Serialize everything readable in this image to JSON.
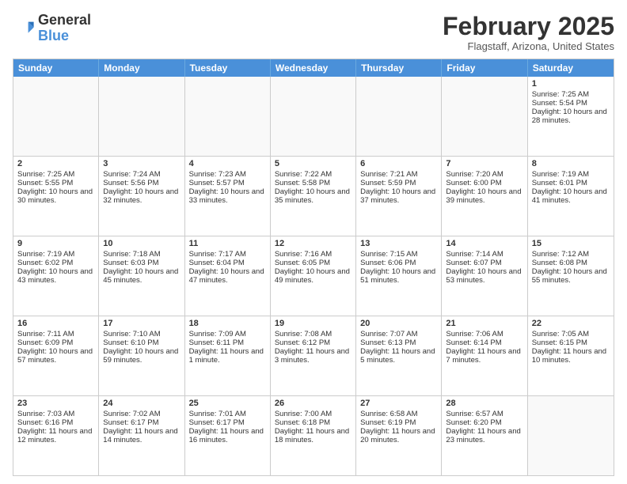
{
  "header": {
    "logo_line1": "General",
    "logo_line2": "Blue",
    "month": "February 2025",
    "location": "Flagstaff, Arizona, United States"
  },
  "weekdays": [
    "Sunday",
    "Monday",
    "Tuesday",
    "Wednesday",
    "Thursday",
    "Friday",
    "Saturday"
  ],
  "rows": [
    [
      {
        "day": "",
        "text": ""
      },
      {
        "day": "",
        "text": ""
      },
      {
        "day": "",
        "text": ""
      },
      {
        "day": "",
        "text": ""
      },
      {
        "day": "",
        "text": ""
      },
      {
        "day": "",
        "text": ""
      },
      {
        "day": "1",
        "text": "Sunrise: 7:25 AM\nSunset: 5:54 PM\nDaylight: 10 hours and 28 minutes."
      }
    ],
    [
      {
        "day": "2",
        "text": "Sunrise: 7:25 AM\nSunset: 5:55 PM\nDaylight: 10 hours and 30 minutes."
      },
      {
        "day": "3",
        "text": "Sunrise: 7:24 AM\nSunset: 5:56 PM\nDaylight: 10 hours and 32 minutes."
      },
      {
        "day": "4",
        "text": "Sunrise: 7:23 AM\nSunset: 5:57 PM\nDaylight: 10 hours and 33 minutes."
      },
      {
        "day": "5",
        "text": "Sunrise: 7:22 AM\nSunset: 5:58 PM\nDaylight: 10 hours and 35 minutes."
      },
      {
        "day": "6",
        "text": "Sunrise: 7:21 AM\nSunset: 5:59 PM\nDaylight: 10 hours and 37 minutes."
      },
      {
        "day": "7",
        "text": "Sunrise: 7:20 AM\nSunset: 6:00 PM\nDaylight: 10 hours and 39 minutes."
      },
      {
        "day": "8",
        "text": "Sunrise: 7:19 AM\nSunset: 6:01 PM\nDaylight: 10 hours and 41 minutes."
      }
    ],
    [
      {
        "day": "9",
        "text": "Sunrise: 7:19 AM\nSunset: 6:02 PM\nDaylight: 10 hours and 43 minutes."
      },
      {
        "day": "10",
        "text": "Sunrise: 7:18 AM\nSunset: 6:03 PM\nDaylight: 10 hours and 45 minutes."
      },
      {
        "day": "11",
        "text": "Sunrise: 7:17 AM\nSunset: 6:04 PM\nDaylight: 10 hours and 47 minutes."
      },
      {
        "day": "12",
        "text": "Sunrise: 7:16 AM\nSunset: 6:05 PM\nDaylight: 10 hours and 49 minutes."
      },
      {
        "day": "13",
        "text": "Sunrise: 7:15 AM\nSunset: 6:06 PM\nDaylight: 10 hours and 51 minutes."
      },
      {
        "day": "14",
        "text": "Sunrise: 7:14 AM\nSunset: 6:07 PM\nDaylight: 10 hours and 53 minutes."
      },
      {
        "day": "15",
        "text": "Sunrise: 7:12 AM\nSunset: 6:08 PM\nDaylight: 10 hours and 55 minutes."
      }
    ],
    [
      {
        "day": "16",
        "text": "Sunrise: 7:11 AM\nSunset: 6:09 PM\nDaylight: 10 hours and 57 minutes."
      },
      {
        "day": "17",
        "text": "Sunrise: 7:10 AM\nSunset: 6:10 PM\nDaylight: 10 hours and 59 minutes."
      },
      {
        "day": "18",
        "text": "Sunrise: 7:09 AM\nSunset: 6:11 PM\nDaylight: 11 hours and 1 minute."
      },
      {
        "day": "19",
        "text": "Sunrise: 7:08 AM\nSunset: 6:12 PM\nDaylight: 11 hours and 3 minutes."
      },
      {
        "day": "20",
        "text": "Sunrise: 7:07 AM\nSunset: 6:13 PM\nDaylight: 11 hours and 5 minutes."
      },
      {
        "day": "21",
        "text": "Sunrise: 7:06 AM\nSunset: 6:14 PM\nDaylight: 11 hours and 7 minutes."
      },
      {
        "day": "22",
        "text": "Sunrise: 7:05 AM\nSunset: 6:15 PM\nDaylight: 11 hours and 10 minutes."
      }
    ],
    [
      {
        "day": "23",
        "text": "Sunrise: 7:03 AM\nSunset: 6:16 PM\nDaylight: 11 hours and 12 minutes."
      },
      {
        "day": "24",
        "text": "Sunrise: 7:02 AM\nSunset: 6:17 PM\nDaylight: 11 hours and 14 minutes."
      },
      {
        "day": "25",
        "text": "Sunrise: 7:01 AM\nSunset: 6:17 PM\nDaylight: 11 hours and 16 minutes."
      },
      {
        "day": "26",
        "text": "Sunrise: 7:00 AM\nSunset: 6:18 PM\nDaylight: 11 hours and 18 minutes."
      },
      {
        "day": "27",
        "text": "Sunrise: 6:58 AM\nSunset: 6:19 PM\nDaylight: 11 hours and 20 minutes."
      },
      {
        "day": "28",
        "text": "Sunrise: 6:57 AM\nSunset: 6:20 PM\nDaylight: 11 hours and 23 minutes."
      },
      {
        "day": "",
        "text": ""
      }
    ]
  ]
}
